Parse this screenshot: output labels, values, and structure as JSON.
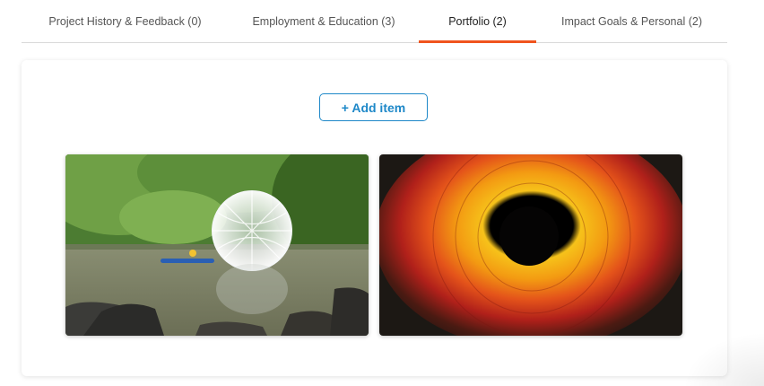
{
  "tabs": [
    {
      "label": "Project History & Feedback (0)",
      "active": false
    },
    {
      "label": "Employment & Education (3)",
      "active": false
    },
    {
      "label": "Portfolio (2)",
      "active": true
    },
    {
      "label": "Impact Goals & Personal (2)",
      "active": false
    }
  ],
  "colors": {
    "accent_tab": "#f0541e",
    "primary": "#1e88c8"
  },
  "portfolio": {
    "add_label": "+ Add item",
    "items": [
      {
        "image": "kayak-lake-geodesic-sphere"
      },
      {
        "image": "autumn-leaves-circle-hole"
      }
    ]
  }
}
